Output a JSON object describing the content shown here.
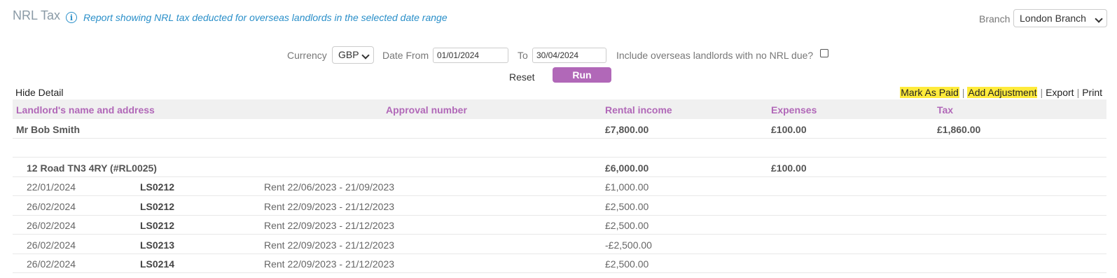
{
  "header": {
    "title": "NRL Tax",
    "info_icon": "info-icon",
    "description": "Report showing NRL tax deducted for overseas landlords in the selected date range",
    "branch_label": "Branch",
    "branch_value": "London Branch"
  },
  "filters": {
    "currency_label": "Currency",
    "currency_value": "GBP",
    "date_from_label": "Date From",
    "date_from_value": "01/01/2024",
    "to_label": "To",
    "to_value": "30/04/2024",
    "include_label": "Include overseas landlords with no NRL due?",
    "include_checked": false,
    "reset_label": "Reset",
    "run_label": "Run"
  },
  "toolbar": {
    "hide_detail": "Hide Detail",
    "mark_as_paid": "Mark As Paid",
    "add_adjustment": "Add Adjustment",
    "export": "Export",
    "print": "Print",
    "highlight_color": "#ffeb3b"
  },
  "table": {
    "columns": [
      "Landlord's name and address",
      "Approval number",
      "Rental income",
      "Expenses",
      "Tax"
    ],
    "landlord": {
      "name": "Mr Bob Smith",
      "rental_income": "£7,800.00",
      "expenses": "£100.00",
      "tax": "£1,860.00"
    },
    "property": {
      "address": "12 Road TN3 4RY (#RL0025)",
      "rental_income": "£6,000.00",
      "expenses": "£100.00"
    },
    "transactions": [
      {
        "date": "22/01/2024",
        "code": "LS0212",
        "description": "Rent 22/06/2023 - 21/09/2023",
        "amount": "£1,000.00"
      },
      {
        "date": "26/02/2024",
        "code": "LS0212",
        "description": "Rent 22/09/2023 - 21/12/2023",
        "amount": "£2,500.00"
      },
      {
        "date": "26/02/2024",
        "code": "LS0212",
        "description": "Rent 22/09/2023 - 21/12/2023",
        "amount": "£2,500.00"
      },
      {
        "date": "26/02/2024",
        "code": "LS0213",
        "description": "Rent 22/09/2023 - 21/12/2023",
        "amount": "-£2,500.00"
      },
      {
        "date": "26/02/2024",
        "code": "LS0214",
        "description": "Rent 22/09/2023 - 21/12/2023",
        "amount": "£2,500.00"
      }
    ]
  },
  "colors": {
    "accent": "#b168b8",
    "info": "#2a8fc9",
    "header_bg": "#f0f0f0"
  }
}
